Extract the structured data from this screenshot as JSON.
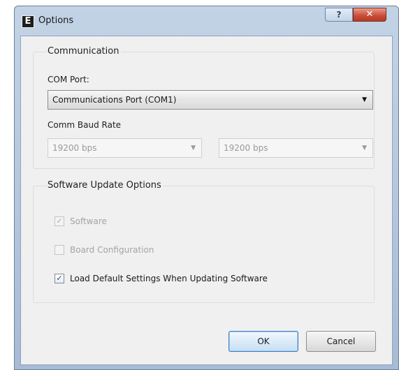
{
  "window": {
    "title": "Options",
    "app_icon_letter": "E",
    "help_label": "?",
    "close_label": "✕"
  },
  "communication": {
    "group_title": "Communication",
    "com_port_label": "COM Port:",
    "com_port_value": "Communications Port (COM1)",
    "baud_label": "Comm Baud Rate",
    "baud_value_1": "19200 bps",
    "baud_value_2": "19200 bps"
  },
  "update": {
    "group_title": "Software Update Options",
    "options": [
      {
        "label": "Software",
        "checked": true,
        "enabled": false
      },
      {
        "label": "Board Configuration",
        "checked": false,
        "enabled": false
      },
      {
        "label": "Load Default Settings When Updating Software",
        "checked": true,
        "enabled": true
      }
    ]
  },
  "buttons": {
    "ok": "OK",
    "cancel": "Cancel"
  },
  "glyphs": {
    "check": "✓",
    "dropdown_arrow": "▼"
  }
}
